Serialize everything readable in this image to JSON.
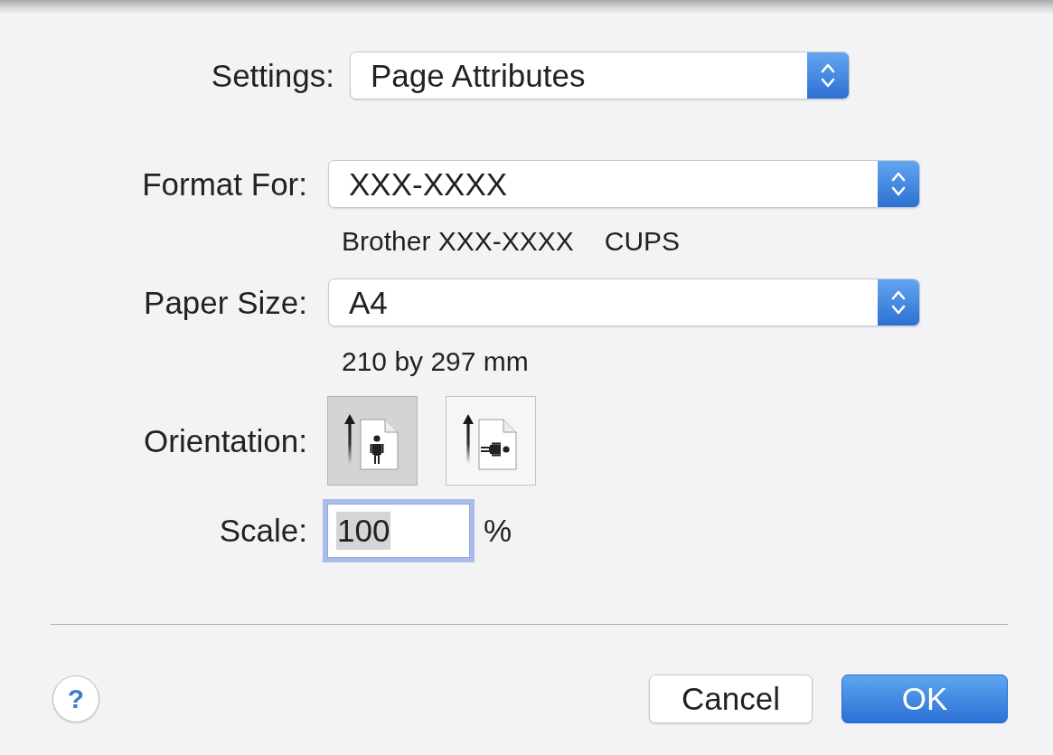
{
  "settings": {
    "label": "Settings:",
    "value": "Page Attributes"
  },
  "format_for": {
    "label": "Format For:",
    "value": "XXX-XXXX",
    "printer_description": "Brother XXX-XXXX",
    "driver": "CUPS"
  },
  "paper_size": {
    "label": "Paper Size:",
    "value": "A4",
    "dimensions": "210 by 297 mm"
  },
  "orientation": {
    "label": "Orientation:",
    "options": [
      {
        "kind": "portrait",
        "selected": true
      },
      {
        "kind": "landscape",
        "selected": false
      }
    ]
  },
  "scale": {
    "label": "Scale:",
    "value": "100",
    "unit": "%",
    "focused": true
  },
  "help_button": {
    "label": "?"
  },
  "buttons": [
    {
      "label": "Cancel",
      "kind": "secondary"
    },
    {
      "label": "OK",
      "kind": "default"
    }
  ]
}
